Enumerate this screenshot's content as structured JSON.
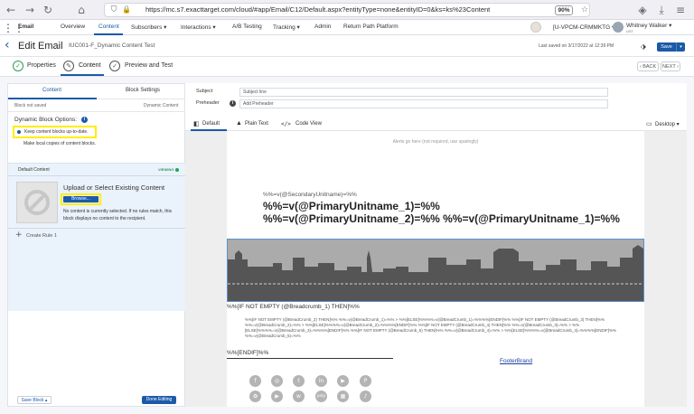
{
  "browser": {
    "url": "https://mc.s7.exacttarget.com/cloud/#app/Email/C12/Default.aspx?entityType=none&entityID=0&ks=ks%23Content",
    "zoom": "90%"
  },
  "app_nav": {
    "app_name": "Email",
    "items": [
      "Overview",
      "Content",
      "Subscribers ▾",
      "Interactions ▾",
      "A/B Testing",
      "Tracking ▾",
      "Admin",
      "Return Path Platform"
    ],
    "active": "Content",
    "account": "[U-VPCM-CRMMKTG ▾",
    "user": "Whitney Walker ▾",
    "user_sub": "UST"
  },
  "email_header": {
    "title": "Edit Email",
    "subtitle": "IUC001-F_Dynamic Content Test",
    "last_saved": "Last saved on 3/17/2022 at 12:39 PM",
    "save_label": "Save"
  },
  "tabs": {
    "properties": "Properties",
    "content": "Content",
    "preview": "Preview and Test",
    "back": "‹ BACK",
    "next": "NEXT ›"
  },
  "left_panel": {
    "tab_content": "Content",
    "tab_block_settings": "Block Settings",
    "block_status": "Block not saved",
    "block_type": "Dynamic Content",
    "dynamic_options_label": "Dynamic Block Options:",
    "option_keep": "Keep content blocks up-to-date.",
    "option_local": "Make local copies of content blocks.",
    "default_content": "Default Content",
    "viewing": "VIEWING",
    "upload_title": "Upload or Select Existing Content",
    "browse": "Browse...",
    "no_content_text": "No content is currently selected. If no rules match, this block displays no content to the recipient.",
    "create_rule": "Create Rule 1",
    "save_block": "Save Block ▴",
    "done_editing": "Done Editing"
  },
  "right_panel": {
    "subject_label": "Subject",
    "subject_placeholder": "Subject line",
    "preheader_label": "Preheader",
    "preheader_placeholder": "Add Preheader",
    "view_default": "Default",
    "view_plain": "Plain Text",
    "view_code": "Code View",
    "device": "Desktop ▾"
  },
  "email_content": {
    "alerts": "Alerts go here (not required, use sparingly)",
    "secondary_unit": "%%=v(@SecondaryUnitname)=%%",
    "primary_unit_1": "%%=v(@PrimaryUnitname_1)=%%",
    "primary_unit_2": "%%=v(@PrimaryUnitname_2)=%% %%=v(@PrimaryUnitname_1)=%%",
    "breadcrumb_if": "%%[IF NOT EMPTY (@Breadcrumb_1) THEN]%%",
    "breadcrumb_code": "%%[IF NOT EMPTY (@BreadCrumb_2) THEN]%% %%=v(@BreadCrumb_1)=%% > %%[ELSE]%%%%=v(@BreadCrumb_1)=%%%%[ENDIF]%% %%[IF NOT EMPTY (@BreadCrumb_3) THEN]%% %%=v(@BreadCrumb_2)=%% > %%[ELSE]%%%%=v(@BreadCrumb_2)=%%%%[ENDIF]%% %%[IF NOT EMPTY (@BreadCrumb_4) THEN]%% %%=v(@BreadCrumb_3)=%% > %%[ELSE]%%%%=v(@BreadCrumb_3)=%%%%[ENDIF]%% %%[IF NOT EMPTY (@BreadCrumb_5) THEN]%% %%=v(@BreadCrumb_4)=%% > %%[ELSE]%%%%=v(@BreadCrumb_4)=%%%%[ENDIF]%% %%=v(@BreadCrumb_5)=%%",
    "endif": "%%[ENDIF]%%",
    "footer_brand": "FooterBrand",
    "social_icons_row1": [
      "f",
      "◎",
      "t",
      "in",
      "▶",
      "P"
    ],
    "social_icons_row2": [
      "✿",
      "▶",
      "w",
      "yelp",
      "▦",
      "♪"
    ]
  },
  "colors": {
    "accent": "#1b5aa8",
    "highlight": "#ffff00",
    "skyline": "#555555"
  }
}
